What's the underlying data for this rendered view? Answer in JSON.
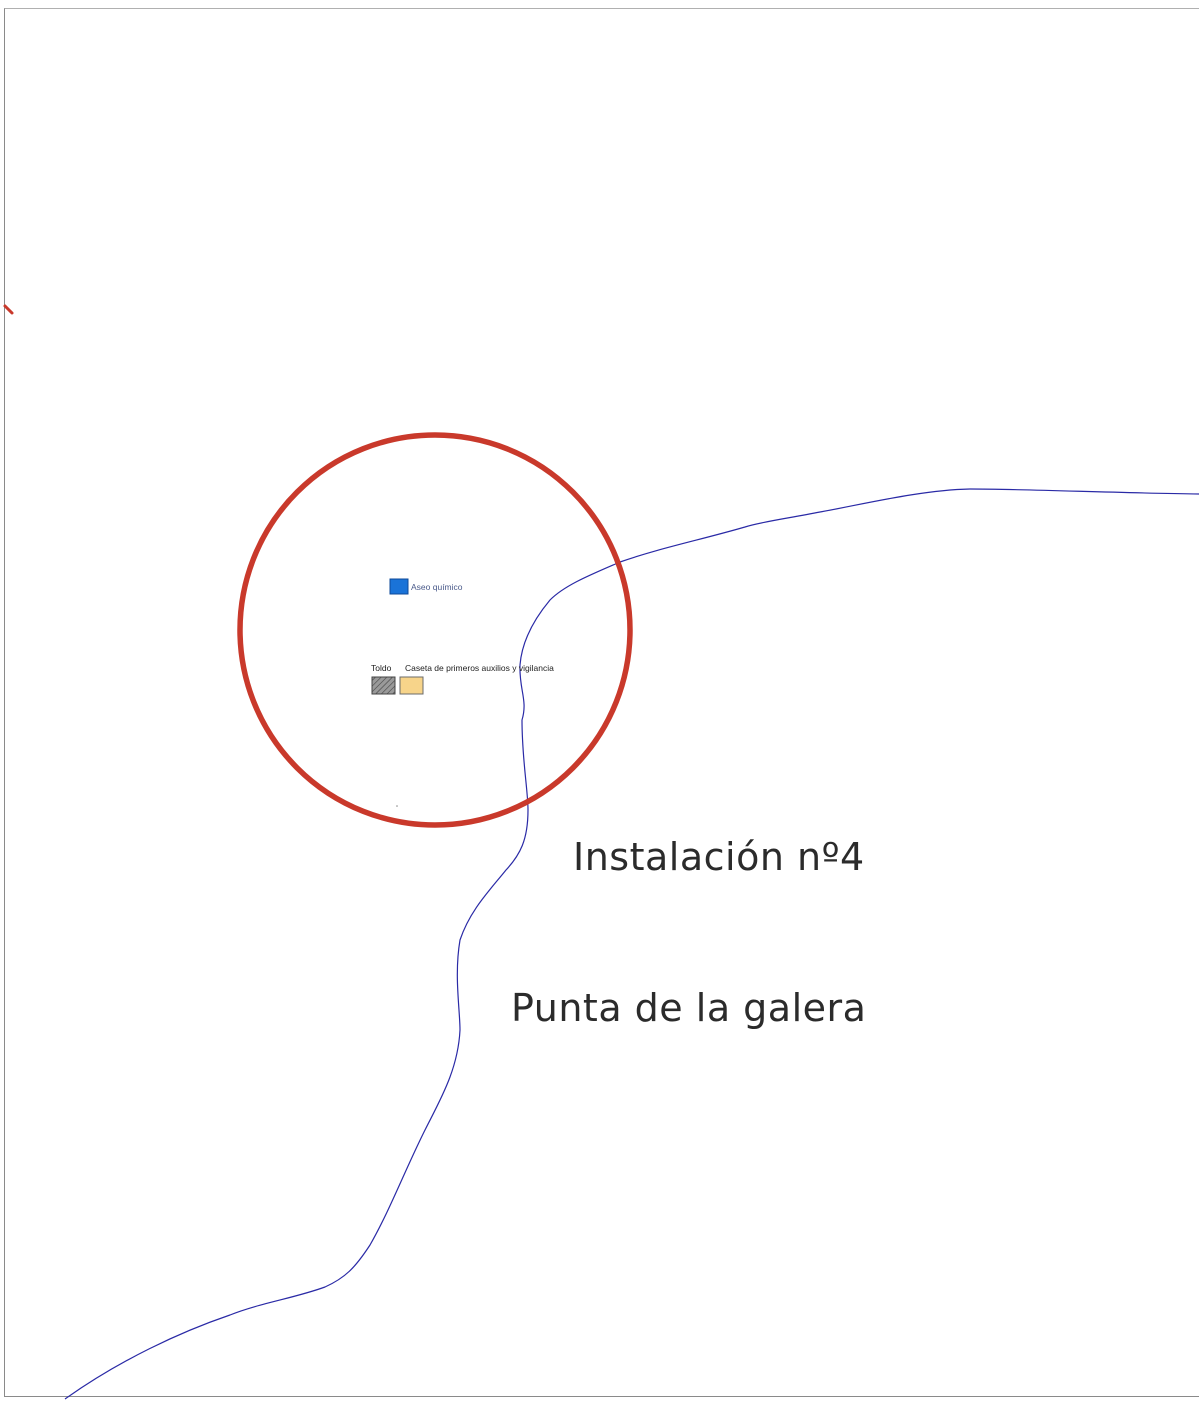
{
  "labels": {
    "aseo": "Aseo químico",
    "toldo": "Toldo",
    "caseta": "Caseta de primeros auxilios y vigilancia",
    "instalacion": "Instalación nº4",
    "punta": "Punta de la galera"
  },
  "colors": {
    "circle": "#c9392b",
    "coastline": "#2a2aa6",
    "aseo_fill": "#1a73d8",
    "toldo_fill": "#8c8c8c",
    "caseta_fill": "#f7d48a"
  },
  "icons": {
    "aseo": "blue-square-icon",
    "toldo": "hatched-square-icon",
    "caseta": "yellow-rectangle-icon"
  }
}
